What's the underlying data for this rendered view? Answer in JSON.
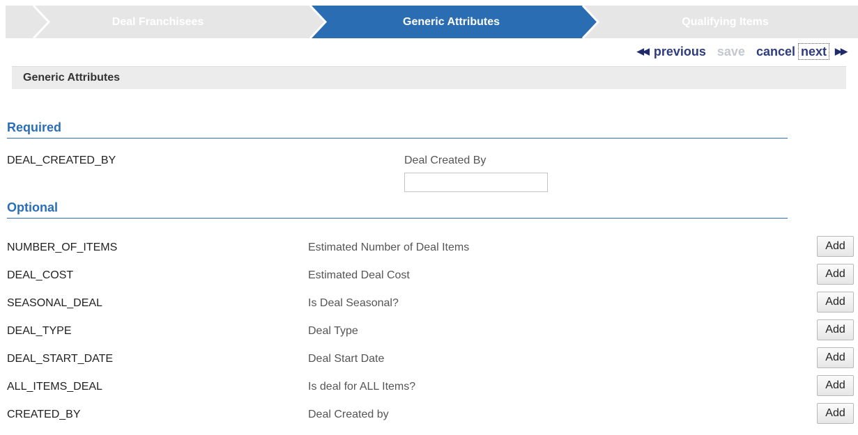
{
  "wizard": {
    "steps": [
      {
        "label": "Deal Franchisees",
        "state": "inactive"
      },
      {
        "label": "Generic Attributes",
        "state": "active"
      },
      {
        "label": "Qualifying Items",
        "state": "inactive"
      }
    ],
    "colors": {
      "active": "#2a6db3",
      "inactive": "#e3e3e3"
    }
  },
  "nav": {
    "prev_icon": "◀◀",
    "previous": "previous",
    "save": "save",
    "cancel": "cancel",
    "next": "next",
    "next_icon": "▶▶"
  },
  "section": {
    "title": "Generic Attributes"
  },
  "required": {
    "heading": "Required",
    "rows": [
      {
        "name": "DEAL_CREATED_BY",
        "description": "Deal Created By",
        "value": ""
      }
    ]
  },
  "optional": {
    "heading": "Optional",
    "add_label": "Add",
    "rows": [
      {
        "name": "NUMBER_OF_ITEMS",
        "description": "Estimated Number of Deal Items"
      },
      {
        "name": "DEAL_COST",
        "description": "Estimated Deal Cost"
      },
      {
        "name": "SEASONAL_DEAL",
        "description": "Is Deal Seasonal?"
      },
      {
        "name": "DEAL_TYPE",
        "description": "Deal Type"
      },
      {
        "name": "DEAL_START_DATE",
        "description": "Deal Start Date"
      },
      {
        "name": "ALL_ITEMS_DEAL",
        "description": "Is deal for ALL Items?"
      },
      {
        "name": "CREATED_BY",
        "description": "Deal Created by"
      }
    ]
  },
  "theme": {
    "accent": "#2a6eb8",
    "nav_link": "#2e3b7e",
    "disabled": "#c3c8cf"
  }
}
